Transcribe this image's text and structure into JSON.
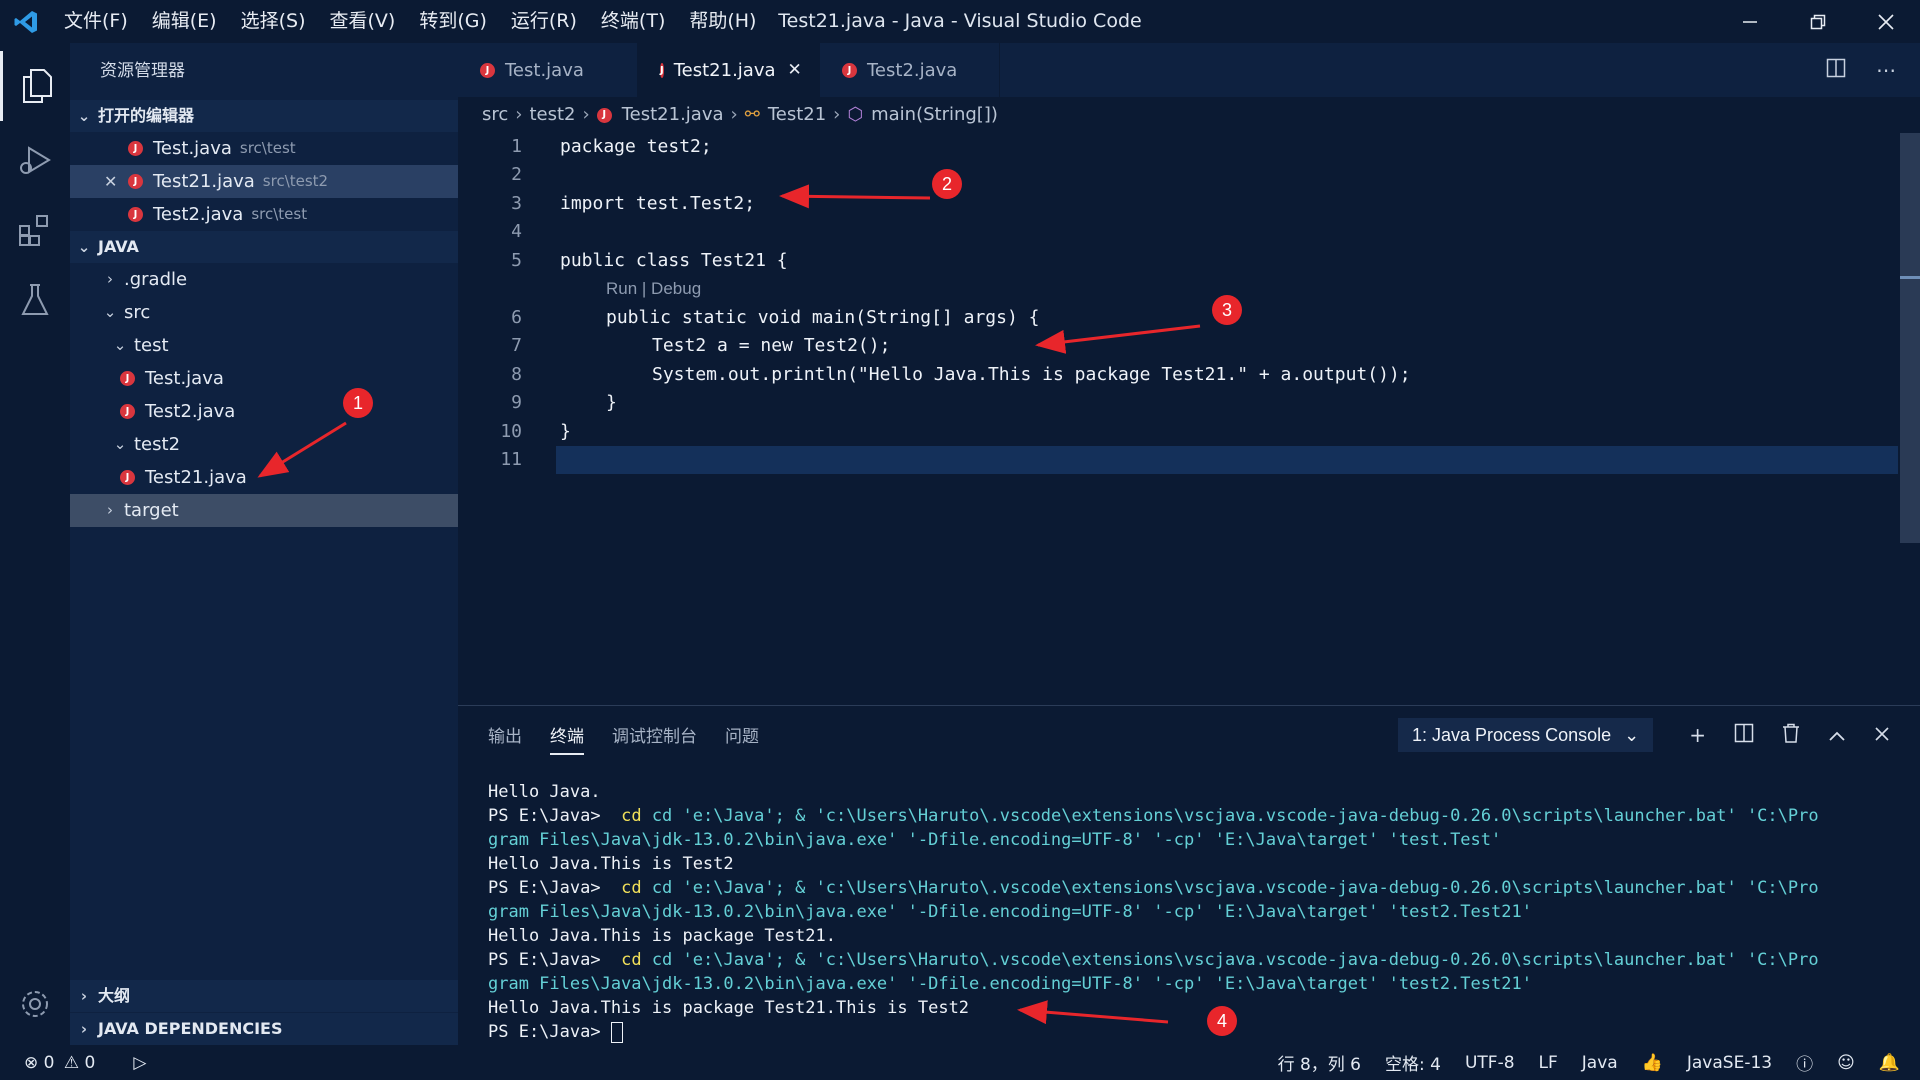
{
  "window": {
    "title": "Test21.java - Java - Visual Studio Code",
    "menu": [
      "文件(F)",
      "编辑(E)",
      "选择(S)",
      "查看(V)",
      "转到(G)",
      "运行(R)",
      "终端(T)",
      "帮助(H)"
    ]
  },
  "sidebar": {
    "title": "资源管理器",
    "open_editors": {
      "label": "打开的编辑器",
      "items": [
        {
          "name": "Test.java",
          "path": "src\\test"
        },
        {
          "name": "Test21.java",
          "path": "src\\test2"
        },
        {
          "name": "Test2.java",
          "path": "src\\test"
        }
      ]
    },
    "project": {
      "label": "JAVA",
      "tree": [
        ".gradle",
        "src",
        "test",
        "Test.java",
        "Test2.java",
        "test2",
        "Test21.java",
        "target"
      ]
    },
    "outline_label": "大纲",
    "deps_label": "JAVA DEPENDENCIES"
  },
  "tabs": [
    {
      "label": "Test.java"
    },
    {
      "label": "Test21.java"
    },
    {
      "label": "Test2.java"
    }
  ],
  "breadcrumbs": [
    "src",
    "test2",
    "Test21.java",
    "Test21",
    "main(String[])"
  ],
  "code": {
    "line_numbers": [
      "1",
      "2",
      "3",
      "4",
      "5",
      "6",
      "7",
      "8",
      "9",
      "10",
      "11"
    ],
    "lines": [
      "package test2;",
      "",
      "import test.Test2;",
      "",
      "public class Test21 {",
      "public static void main(String[] args) {",
      "Test2 a = new Test2();",
      "System.out.println(\"Hello Java.This is package Test21.\" + a.output());",
      "}",
      "}",
      ""
    ],
    "codelens": "Run | Debug"
  },
  "panel": {
    "tabs": [
      "输出",
      "终端",
      "调试控制台",
      "问题"
    ],
    "console_select": "1: Java Process Console",
    "terminal": [
      "Hello Java.",
      "PS E:\\Java>",
      "cd 'e:\\Java'; & 'c:\\Users\\Haruto\\.vscode\\extensions\\vscjava.vscode-java-debug-0.26.0\\scripts\\launcher.bat' 'C:\\Pro",
      "gram Files\\Java\\jdk-13.0.2\\bin\\java.exe' '-Dfile.encoding=UTF-8' '-cp' 'E:\\Java\\target' 'test.Test'",
      "Hello Java.This is Test2",
      "gram Files\\Java\\jdk-13.0.2\\bin\\java.exe' '-Dfile.encoding=UTF-8' '-cp' 'E:\\Java\\target' 'test2.Test21'",
      "Hello Java.This is package Test21.",
      "Hello Java.This is package Test21.This is Test2",
      "PS E:\\Java> "
    ]
  },
  "status": {
    "errors": "0",
    "warnings": "0",
    "position": "行 8，列 6",
    "spaces": "空格: 4",
    "encoding": "UTF-8",
    "eol": "LF",
    "language": "Java",
    "runtime": "JavaSE-13"
  },
  "annotations": [
    "1",
    "2",
    "3",
    "4"
  ],
  "colors": {
    "accent": "#e8262b",
    "background": "#0b1a33",
    "sidebar": "#0e2140",
    "java_icon": "#d9363e"
  }
}
